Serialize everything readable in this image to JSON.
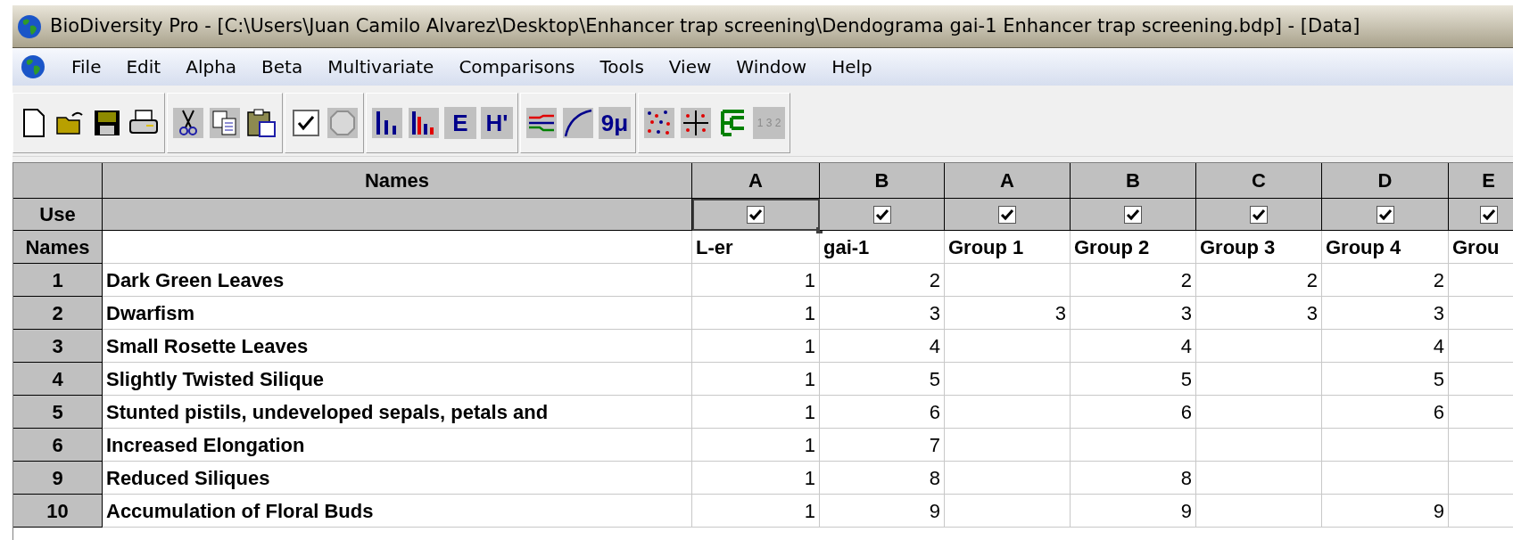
{
  "window": {
    "title": "BioDiversity Pro - [C:\\Users\\Juan Camilo Alvarez\\Desktop\\Enhancer trap screening\\Dendograma gai-1 Enhancer trap screening.bdp] - [Data]"
  },
  "menu": [
    "File",
    "Edit",
    "Alpha",
    "Beta",
    "Multivariate",
    "Comparisons",
    "Tools",
    "View",
    "Window",
    "Help"
  ],
  "toolbar_groups": [
    [
      {
        "kind": "new"
      },
      {
        "kind": "open"
      },
      {
        "kind": "save"
      },
      {
        "kind": "print"
      }
    ],
    [
      {
        "kind": "cut"
      },
      {
        "kind": "copy"
      },
      {
        "kind": "paste"
      }
    ],
    [
      {
        "kind": "checkbox"
      },
      {
        "kind": "circle"
      }
    ],
    [
      {
        "kind": "bars"
      },
      {
        "kind": "redbars"
      },
      {
        "kind": "glyph",
        "label": "E"
      },
      {
        "kind": "glyph",
        "label": "H'"
      }
    ],
    [
      {
        "kind": "lines"
      },
      {
        "kind": "curve"
      },
      {
        "kind": "glyph",
        "label": "9μ"
      }
    ],
    [
      {
        "kind": "dots"
      },
      {
        "kind": "cross"
      },
      {
        "kind": "tree"
      },
      {
        "kind": "small_glyph",
        "label": "1 3 2"
      }
    ]
  ],
  "grid": {
    "corner_header": "Names",
    "use_label": "Use",
    "names_label": "Names",
    "columns": [
      {
        "letter": "A",
        "use_checked": true,
        "selected": true,
        "name": "L-er"
      },
      {
        "letter": "B",
        "use_checked": true,
        "selected": false,
        "name": "gai-1"
      },
      {
        "letter": "A",
        "use_checked": true,
        "selected": false,
        "name": "Group 1"
      },
      {
        "letter": "B",
        "use_checked": true,
        "selected": false,
        "name": "Group 2"
      },
      {
        "letter": "C",
        "use_checked": true,
        "selected": false,
        "name": "Group 3"
      },
      {
        "letter": "D",
        "use_checked": true,
        "selected": false,
        "name": "Group 4"
      },
      {
        "letter": "E",
        "use_checked": true,
        "selected": false,
        "name": "Grou"
      }
    ],
    "rows": [
      {
        "number": "1",
        "name": "Dark Green Leaves",
        "values": {
          "column_1": "1",
          "column_2": "2",
          "column_4": "2",
          "column_5": "2",
          "column_6": "2"
        }
      },
      {
        "number": "2",
        "name": "Dwarfism",
        "values": {
          "column_1": "1",
          "column_2": "3",
          "column_3": "3",
          "column_4": "3",
          "column_5": "3",
          "column_6": "3"
        }
      },
      {
        "number": "3",
        "name": "Small Rosette Leaves",
        "values": {
          "column_1": "1",
          "column_2": "4",
          "column_4": "4",
          "column_6": "4"
        }
      },
      {
        "number": "4",
        "name": "Slightly Twisted Silique",
        "values": {
          "column_1": "1",
          "column_2": "5",
          "column_4": "5",
          "column_6": "5"
        }
      },
      {
        "number": "5",
        "name": "Stunted pistils, undeveloped sepals, petals and",
        "values": {
          "column_1": "1",
          "column_2": "6",
          "column_4": "6",
          "column_6": "6"
        }
      },
      {
        "number": "6",
        "name": "Increased Elongation",
        "values": {
          "column_1": "1",
          "column_2": "7"
        }
      },
      {
        "number": "9",
        "name": "Reduced Siliques",
        "values": {
          "column_1": "1",
          "column_2": "8",
          "column_4": "8"
        }
      },
      {
        "number": "10",
        "name": "Accumulation of Floral Buds",
        "values": {
          "column_1": "1",
          "column_2": "9",
          "column_4": "9",
          "column_6": "9"
        }
      }
    ]
  }
}
